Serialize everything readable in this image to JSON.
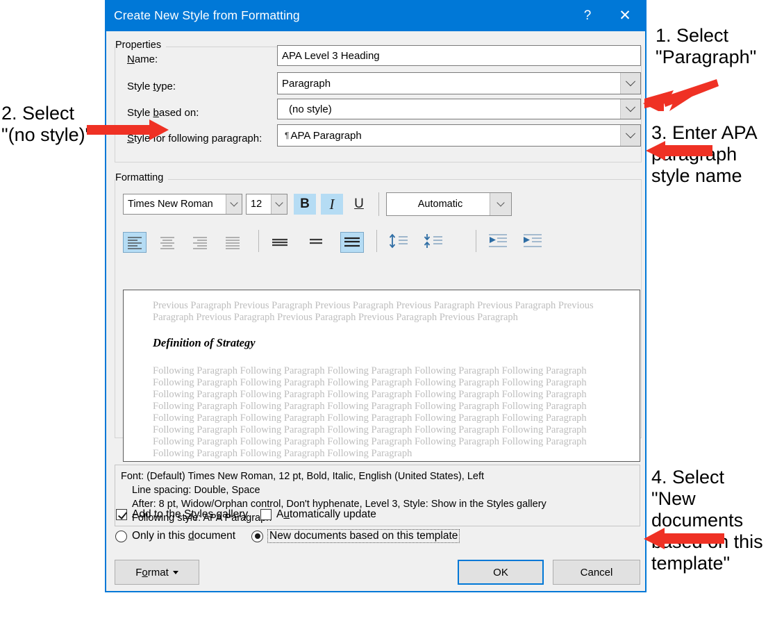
{
  "dialog": {
    "title": "Create New Style from Formatting",
    "help_icon": "?",
    "close_icon": "✕"
  },
  "properties": {
    "group_label": "Properties",
    "name_label": "Name:",
    "name_value": "APA Level 3 Heading",
    "style_type_label": "Style type:",
    "style_type_value": "Paragraph",
    "style_based_on_label": "Style based on:",
    "style_based_on_value": "(no style)",
    "style_following_label": "Style for following paragraph:",
    "style_following_value": "APA Paragraph",
    "pilcrow": "¶"
  },
  "formatting": {
    "group_label": "Formatting",
    "font_family": "Times New Roman",
    "font_size": "12",
    "bold_label": "B",
    "italic_label": "I",
    "underline_label": "U",
    "font_color": "Automatic",
    "align_left": "align-left",
    "align_center": "align-center",
    "align_right": "align-right",
    "align_justify": "align-justify",
    "spacing_single": "line-spacing-single",
    "spacing_onefive": "line-spacing-1.5",
    "spacing_double": "line-spacing-double",
    "space_before": "decrease-space-before",
    "space_after": "increase-space-after",
    "indent_decrease": "decrease-indent",
    "indent_increase": "increase-indent",
    "highlight_color": "#b5dcf4"
  },
  "preview": {
    "before_text": "Previous Paragraph Previous Paragraph Previous Paragraph Previous Paragraph Previous Paragraph Previous Paragraph Previous Paragraph Previous Paragraph Previous Paragraph Previous Paragraph",
    "heading_text": "Definition of Strategy",
    "after_text": "Following Paragraph Following Paragraph Following Paragraph Following Paragraph Following Paragraph Following Paragraph Following Paragraph Following Paragraph Following Paragraph Following Paragraph Following Paragraph Following Paragraph Following Paragraph Following Paragraph Following Paragraph Following Paragraph Following Paragraph Following Paragraph Following Paragraph Following Paragraph Following Paragraph Following Paragraph Following Paragraph Following Paragraph Following Paragraph Following Paragraph Following Paragraph Following Paragraph Following Paragraph Following Paragraph Following Paragraph Following Paragraph Following Paragraph Following Paragraph Following Paragraph Following Paragraph Following Paragraph Following Paragraph"
  },
  "description": {
    "line1": "Font: (Default) Times New Roman, 12 pt, Bold, Italic, English (United States), Left",
    "line2": "Line spacing:  Double, Space",
    "line3": "After:  8 pt, Widow/Orphan control, Don't hyphenate, Level 3, Style: Show in the Styles gallery",
    "line4": "Following style: APA Paragraph"
  },
  "options": {
    "add_to_gallery_label_pre": "Add to the ",
    "add_to_gallery_label_key": "S",
    "add_to_gallery_label_post": "tyles gallery",
    "add_to_gallery_checked": true,
    "auto_update_label_pre": "A",
    "auto_update_label_key": "u",
    "auto_update_label_post": "tomatically update",
    "auto_update_checked": false,
    "only_this_document_label": "Only in this document",
    "only_this_document_checked": false,
    "new_documents_label": "New documents based on this template",
    "new_documents_checked": true
  },
  "buttons": {
    "format": "Format",
    "ok": "OK",
    "cancel": "Cancel"
  },
  "annotations": [
    {
      "id": 1,
      "lines": [
        "1. Select",
        "\"Paragraph\""
      ]
    },
    {
      "id": 2,
      "lines": [
        "2. Select",
        "\"(no style)\""
      ]
    },
    {
      "id": 3,
      "lines": [
        "3. Enter APA",
        "paragraph",
        "style name"
      ]
    },
    {
      "id": 4,
      "lines": [
        "4. Select",
        "\"New",
        "documents",
        "based on this",
        "template\""
      ]
    }
  ],
  "annotation_color": "#ef3124"
}
